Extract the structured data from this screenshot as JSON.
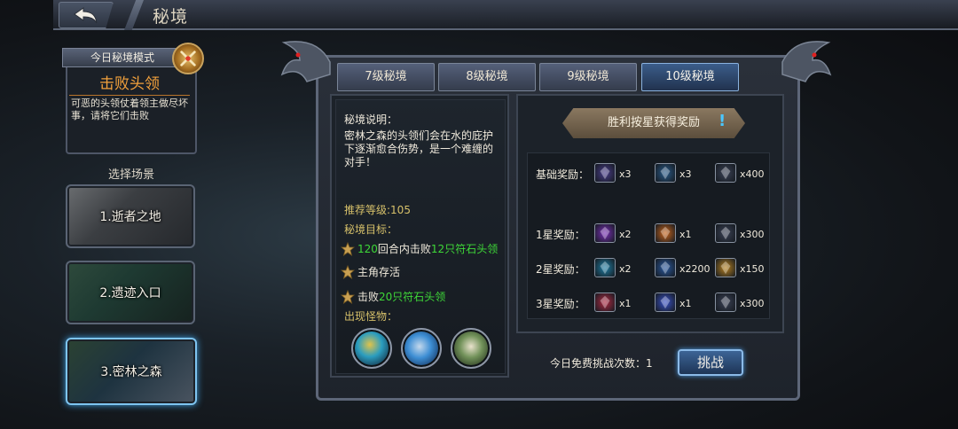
{
  "header": {
    "title": "秘境"
  },
  "mode": {
    "header": "今日秘境模式",
    "name": "击败头领",
    "description": "可恶的头领仗着领主做尽坏事，请将它们击败"
  },
  "scenes": {
    "label": "选择场景",
    "items": [
      {
        "label": "1.逝者之地"
      },
      {
        "label": "2.遗迹入口"
      },
      {
        "label": "3.密林之森",
        "selected": true
      }
    ]
  },
  "tabs": [
    {
      "label": "7级秘境"
    },
    {
      "label": "8级秘境"
    },
    {
      "label": "9级秘境"
    },
    {
      "label": "10级秘境",
      "active": true
    }
  ],
  "info": {
    "desc_title": "秘境说明：",
    "desc_body": "密林之森的头领们会在水的庇护下逐渐愈合伤势，是一个难缠的对手！",
    "recommended_level": "推荐等级:105",
    "goal_title": "秘境目标：",
    "goals": [
      {
        "num": "120",
        "mid": "回合内击败",
        "target": "12只符石头领"
      },
      {
        "text": "主角存活"
      },
      {
        "pre": "击败",
        "target": "20只符石头领"
      }
    ],
    "monster_title": "出现怪物："
  },
  "rewards": {
    "banner": "胜利按星获得奖励",
    "banner_mark": "!",
    "rows": [
      {
        "label": "基础奖励：",
        "items": [
          {
            "icon": "rune-chip-blue-icon",
            "qty": "x3",
            "color": "#4a3d8c"
          },
          {
            "icon": "rune-chip-cyan-icon",
            "qty": "x3",
            "color": "#2a5c8c"
          },
          {
            "icon": "scroll-icon",
            "qty": "x400",
            "color": "#3b4256"
          }
        ]
      },
      {
        "label": "1星奖励：",
        "items": [
          {
            "icon": "purple-gem-icon",
            "qty": "x2",
            "color": "#7a2fb8"
          },
          {
            "icon": "orange-gem-icon",
            "qty": "x1",
            "color": "#c9651c"
          },
          {
            "icon": "scroll-icon",
            "qty": "x300",
            "color": "#3b4256"
          }
        ]
      },
      {
        "label": "2星奖励：",
        "items": [
          {
            "icon": "teal-gem-icon",
            "qty": "x2",
            "color": "#1f7fa6"
          },
          {
            "icon": "blue-rune-coin-icon",
            "qty": "x2200",
            "color": "#2a5aa0"
          },
          {
            "icon": "gold-coin-icon",
            "qty": "x150",
            "color": "#b88220"
          }
        ]
      },
      {
        "label": "3星奖励：",
        "items": [
          {
            "icon": "red-gem-icon",
            "qty": "x1",
            "color": "#b02a44"
          },
          {
            "icon": "blue-crystal-icon",
            "qty": "x1",
            "color": "#3a52c8"
          },
          {
            "icon": "scroll-icon",
            "qty": "x300",
            "color": "#3b4256"
          }
        ]
      }
    ]
  },
  "footer": {
    "free_challenges": "今日免费挑战次数：1",
    "challenge_button": "挑战"
  }
}
